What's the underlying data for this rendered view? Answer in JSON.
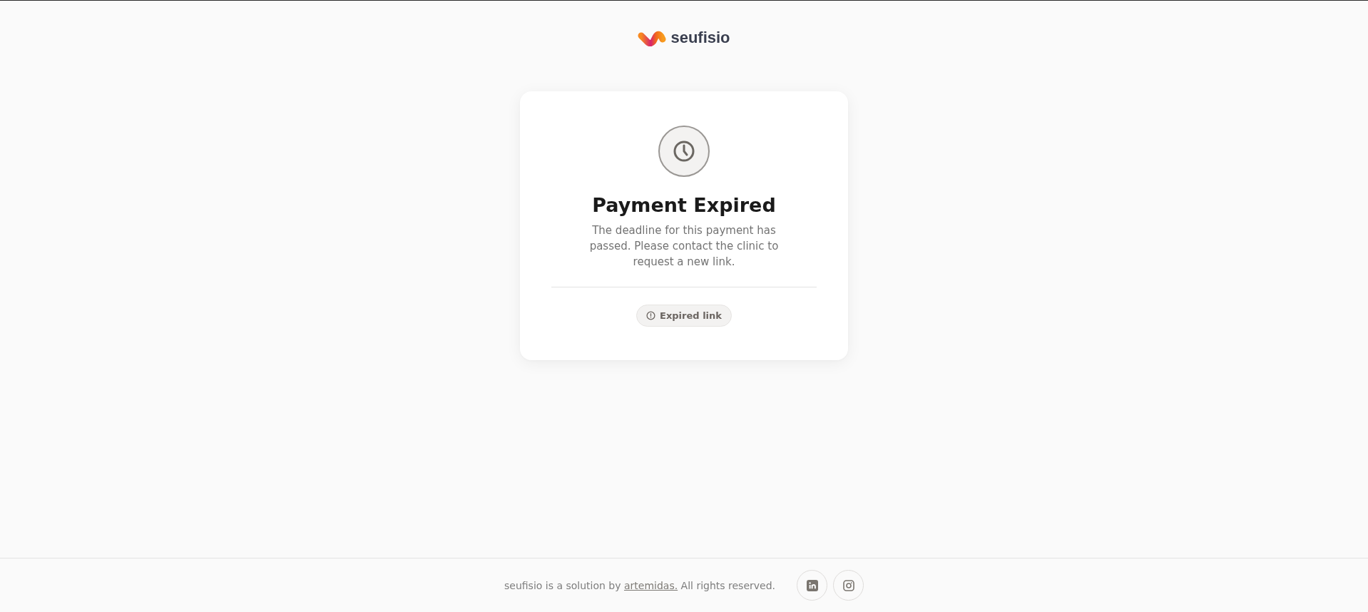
{
  "header": {
    "logo_text": "seufisio"
  },
  "card": {
    "title": "Payment Expired",
    "message": "The deadline for this payment has passed. Please contact the clinic to request a new link.",
    "badge": "Expired link"
  },
  "footer": {
    "text_before": "seufisio is a solution by",
    "link": "artemidas.",
    "text_after": "All rights reserved.",
    "social_links": [
      {
        "kind": "linkedin"
      },
      {
        "kind": "instagram"
      }
    ]
  }
}
